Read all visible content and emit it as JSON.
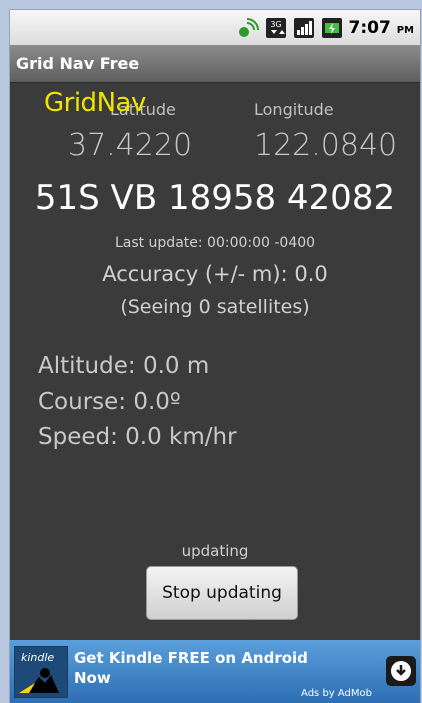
{
  "status_bar": {
    "time": "7:07",
    "ampm": "PM",
    "icons": [
      "gps-signal-icon",
      "3g-data-icon",
      "signal-bars-icon",
      "battery-charging-icon"
    ]
  },
  "app": {
    "title": "Grid Nav Free",
    "logo": "GridNav"
  },
  "coords": {
    "lat_label": "Latitude",
    "lon_label": "Longitude",
    "lat_value": "37.4220",
    "lon_value": "122.0840",
    "grid_ref": "51S VB 18958 42082"
  },
  "meta": {
    "last_update": "Last update: 00:00:00 -0400",
    "accuracy": "Accuracy (+/- m): 0.0",
    "satellites": "(Seeing 0 satellites)"
  },
  "readings": {
    "altitude": "Altitude: 0.0 m",
    "course": "Course: 0.0º",
    "speed": "Speed: 0.0 km/hr"
  },
  "update": {
    "status": "updating",
    "button": "Stop updating"
  },
  "ad": {
    "brand": "kindle",
    "headline": "Get Kindle FREE on Android Now",
    "attribution": "Ads by AdMob",
    "colors": {
      "top": "#5a9fdc",
      "bottom": "#2d6fb3"
    }
  },
  "colors": {
    "logo": "#f0e400",
    "background": "#3b3b3b"
  }
}
